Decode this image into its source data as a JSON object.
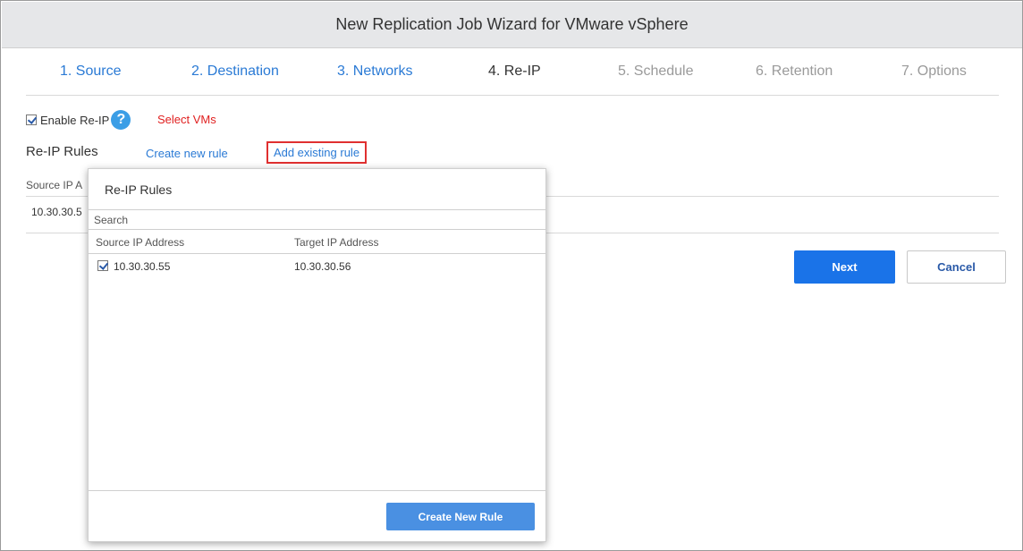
{
  "window": {
    "title": "New Replication Job Wizard for VMware vSphere"
  },
  "steps": [
    {
      "label": "1. Source",
      "state": "done"
    },
    {
      "label": "2. Destination",
      "state": "done"
    },
    {
      "label": "3. Networks",
      "state": "done"
    },
    {
      "label": "4. Re-IP",
      "state": "current"
    },
    {
      "label": "5. Schedule",
      "state": "future"
    },
    {
      "label": "6. Retention",
      "state": "future"
    },
    {
      "label": "7. Options",
      "state": "future"
    }
  ],
  "reip": {
    "enable_label": "Enable Re-IP",
    "enable_checked": true,
    "help_icon": "?",
    "select_vms": "Select VMs",
    "rules_label": "Re-IP Rules",
    "create_new_rule": "Create new rule",
    "add_existing_rule": "Add existing rule"
  },
  "background_table": {
    "header_partial": "Source IP A",
    "row_partial": "10.30.30.5"
  },
  "buttons": {
    "next": "Next",
    "cancel": "Cancel"
  },
  "modal": {
    "title": "Re-IP Rules",
    "search_placeholder": "Search",
    "columns": [
      "Source IP Address",
      "Target IP Address"
    ],
    "rows": [
      {
        "checked": true,
        "source": "10.30.30.55",
        "target": "10.30.30.56"
      }
    ],
    "create_button": "Create New Rule"
  },
  "colors": {
    "link_blue": "#2a7ad5",
    "accent_red": "#e02020",
    "primary_button": "#1a73e8",
    "modal_button": "#4a90e2"
  }
}
